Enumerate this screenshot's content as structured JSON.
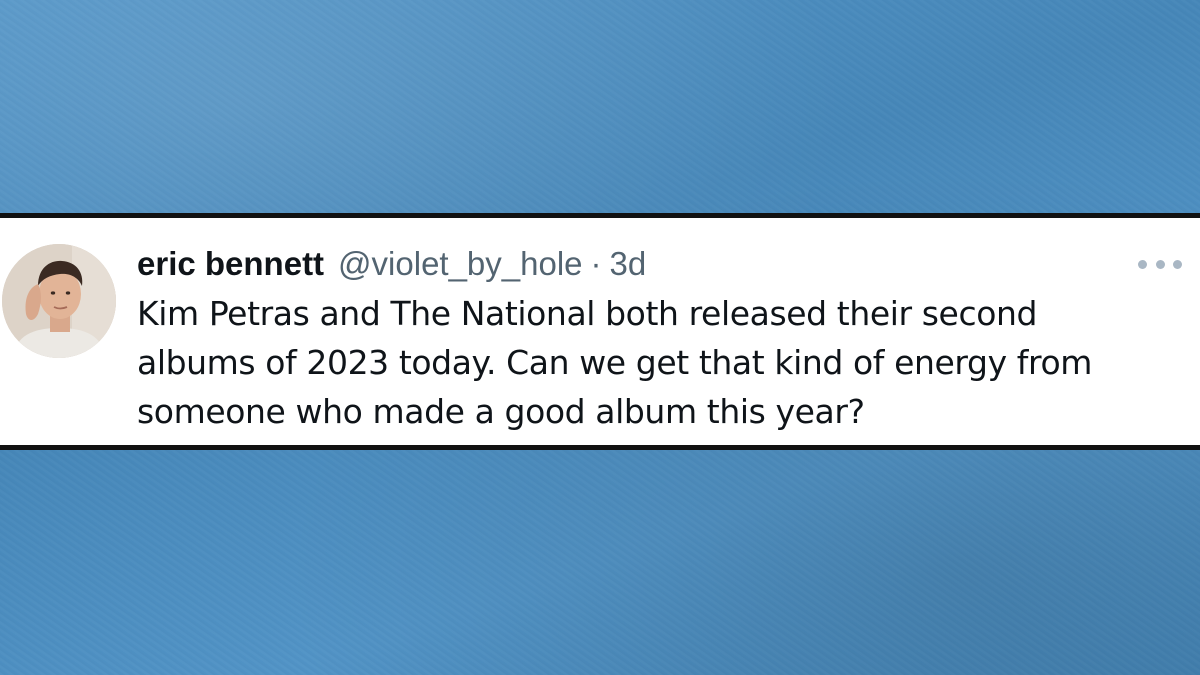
{
  "tweet": {
    "display_name": "eric bennett",
    "handle": "@violet_by_hole",
    "separator": "·",
    "timestamp": "3d",
    "text_lines": [
      "Kim Petras and The National both released their second",
      "albums of 2023 today. Can we get that kind of energy from",
      "someone who made a good album this year?"
    ],
    "avatar_icon": "user-photo-avatar",
    "more_icon": "more-horizontal-icon"
  },
  "colors": {
    "background": "#4a8fc4",
    "card": "#ffffff",
    "card_border": "#111111",
    "name_text": "#0f1419",
    "meta_text": "#536471",
    "more_dots": "#a9b7c4"
  }
}
